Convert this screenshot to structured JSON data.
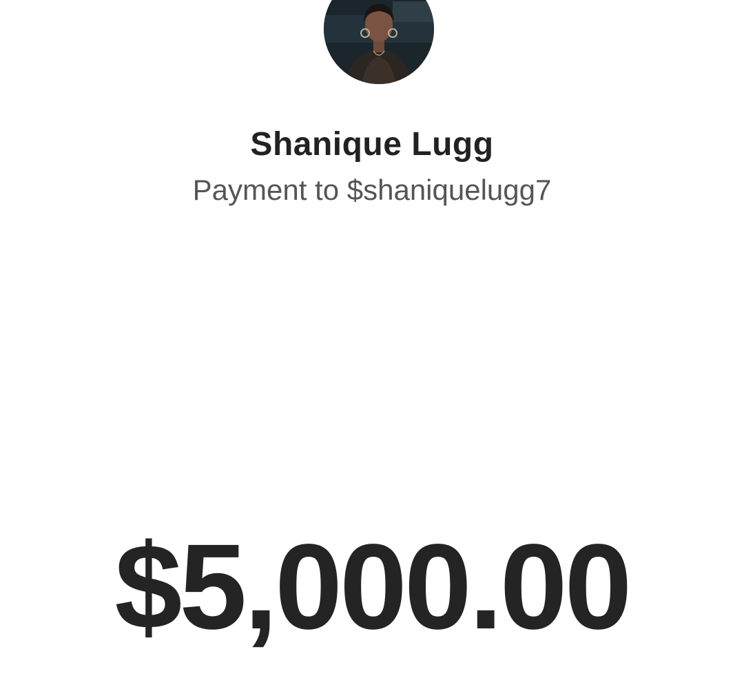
{
  "recipient": {
    "name": "Shanique Lugg",
    "subtitle": "Payment to $shaniquelugg7"
  },
  "payment": {
    "amount": "$5,000.00"
  }
}
